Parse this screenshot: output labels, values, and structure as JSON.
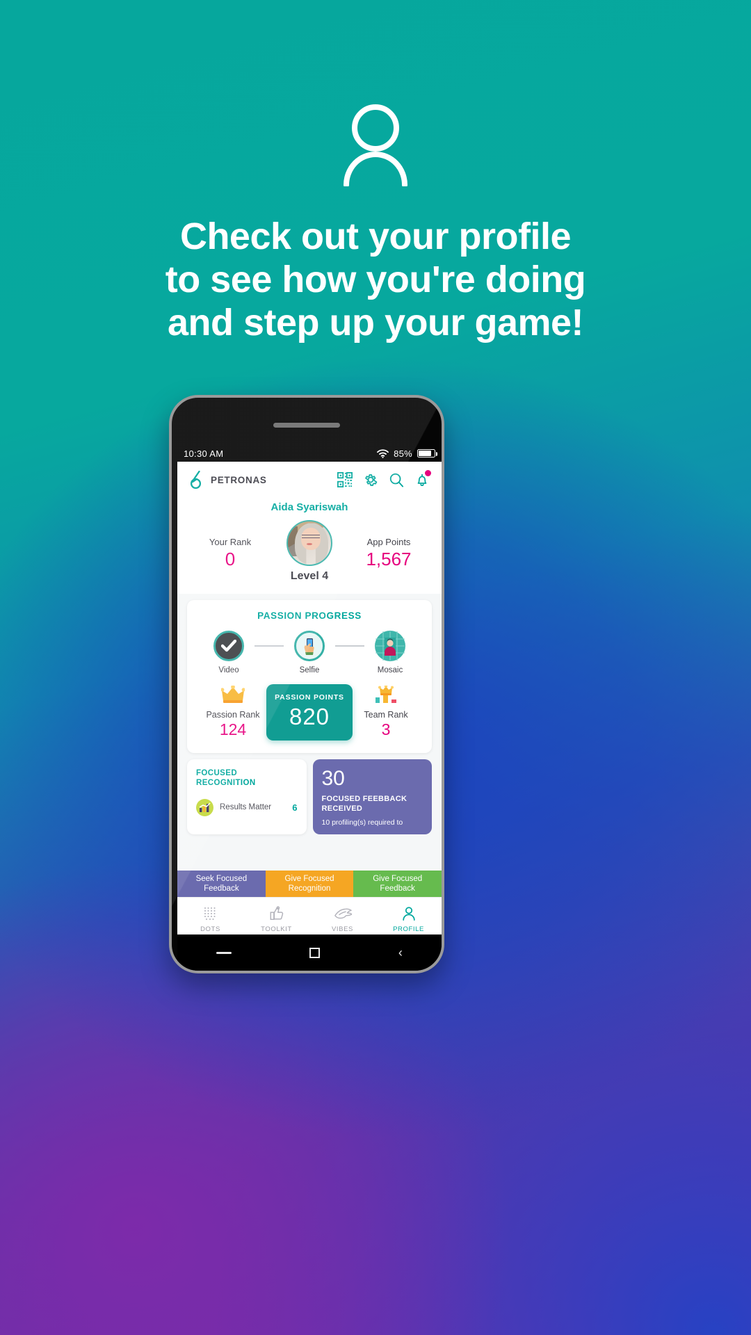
{
  "hero": {
    "icon": "person-icon",
    "headline_lines": [
      "Check out your profile",
      "to see how you're doing",
      "and step up your game!"
    ]
  },
  "phone": {
    "status_bar": {
      "time": "10:30 AM",
      "wifi_icon": "wifi-icon",
      "battery_percent": "85%",
      "battery_icon": "battery-icon"
    },
    "soft_keys": {
      "recent": "recent-apps-key",
      "home": "home-key",
      "back": "back-key"
    }
  },
  "app": {
    "header": {
      "logo": "petronas-logo-icon",
      "brand": "PETRONAS",
      "icons": [
        {
          "name": "qr-code-icon"
        },
        {
          "name": "gear-icon"
        },
        {
          "name": "search-icon"
        },
        {
          "name": "bell-icon",
          "badge": true
        }
      ]
    },
    "profile": {
      "name": "Aida Syariswah",
      "avatar": "user-avatar",
      "level": "Level 4",
      "your_rank_label": "Your Rank",
      "your_rank_value": "0",
      "app_points_label": "App Points",
      "app_points_value": "1,567"
    },
    "passion_progress": {
      "title": "PASSION PROGRESS",
      "steps": [
        {
          "label": "Video",
          "icon": "check-icon",
          "state": "complete"
        },
        {
          "label": "Selfie",
          "icon": "phone-hand-icon",
          "state": "current"
        },
        {
          "label": "Mosaic",
          "icon": "mosaic-portrait-icon",
          "state": "locked"
        }
      ],
      "passion_rank_label": "Passion Rank",
      "passion_rank_value": "124",
      "passion_rank_icon": "crown-icon",
      "points_title": "PASSION POINTS",
      "points_value": "820",
      "team_rank_label": "Team Rank",
      "team_rank_value": "3",
      "team_rank_icon": "crown-chart-icon"
    },
    "focused_recognition": {
      "title_line1": "FOCUSED",
      "title_line2": "RECOGNITION",
      "item_icon": "results-chart-icon",
      "item_name": "Results Matter",
      "item_count": "6"
    },
    "focused_feedback": {
      "count": "30",
      "title_line1": "FOCUSED FEEBBACK",
      "title_line2": "RECEIVED",
      "note": "10 profiling(s) required to"
    },
    "action_bar": [
      {
        "label": "Seek Focused Feedback",
        "color": "#6b6bae"
      },
      {
        "label": "Give Focused Recognition",
        "color": "#f5a623"
      },
      {
        "label": "Give Focused Feedback",
        "color": "#66bb4e"
      }
    ],
    "bottom_nav": [
      {
        "label": "DOTS",
        "icon": "dots-grid-icon",
        "active": false
      },
      {
        "label": "TOOLKIT",
        "icon": "thumbs-up-icon",
        "active": false
      },
      {
        "label": "VIBES",
        "icon": "bird-icon",
        "active": false
      },
      {
        "label": "PROFILE",
        "icon": "person-icon",
        "active": true
      }
    ]
  },
  "colors": {
    "teal": "#00a79d",
    "magenta": "#e6007e",
    "purple": "#6b6bae",
    "orange": "#f5a623",
    "green": "#66bb4e"
  }
}
